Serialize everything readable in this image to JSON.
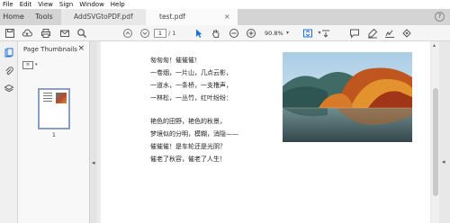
{
  "menu": [
    "File",
    "Edit",
    "View",
    "Sign",
    "Window",
    "Help"
  ],
  "tabs": {
    "home": "Home",
    "tools": "Tools",
    "docs": [
      {
        "label": "AddSVGtoPDF.pdf",
        "active": false
      },
      {
        "label": "test.pdf",
        "active": true
      }
    ]
  },
  "toolbar": {
    "current_page": "1",
    "page_count": "/ 1",
    "zoom": "90.8%"
  },
  "thumbnails": {
    "title": "Page Thumbnails",
    "page_label": "1"
  },
  "poem": [
    "匆匆匆！催催催！",
    "一卷烟，一片山，几点云影，",
    "一道水，一条桥，一支橹声，",
    "一林松，一丛竹，红叶纷纷：",
    "",
    "艳色的田野，艳色的秋景，",
    "梦境似的分明，模糊，消隐——",
    "催催催！是车轮还是光阴？",
    "催老了秋容，催老了人生！"
  ],
  "colors": {
    "tab_active": "#fafafa",
    "accent_blue": "#1a73d9",
    "thumb_border": "#8aa0c0"
  }
}
